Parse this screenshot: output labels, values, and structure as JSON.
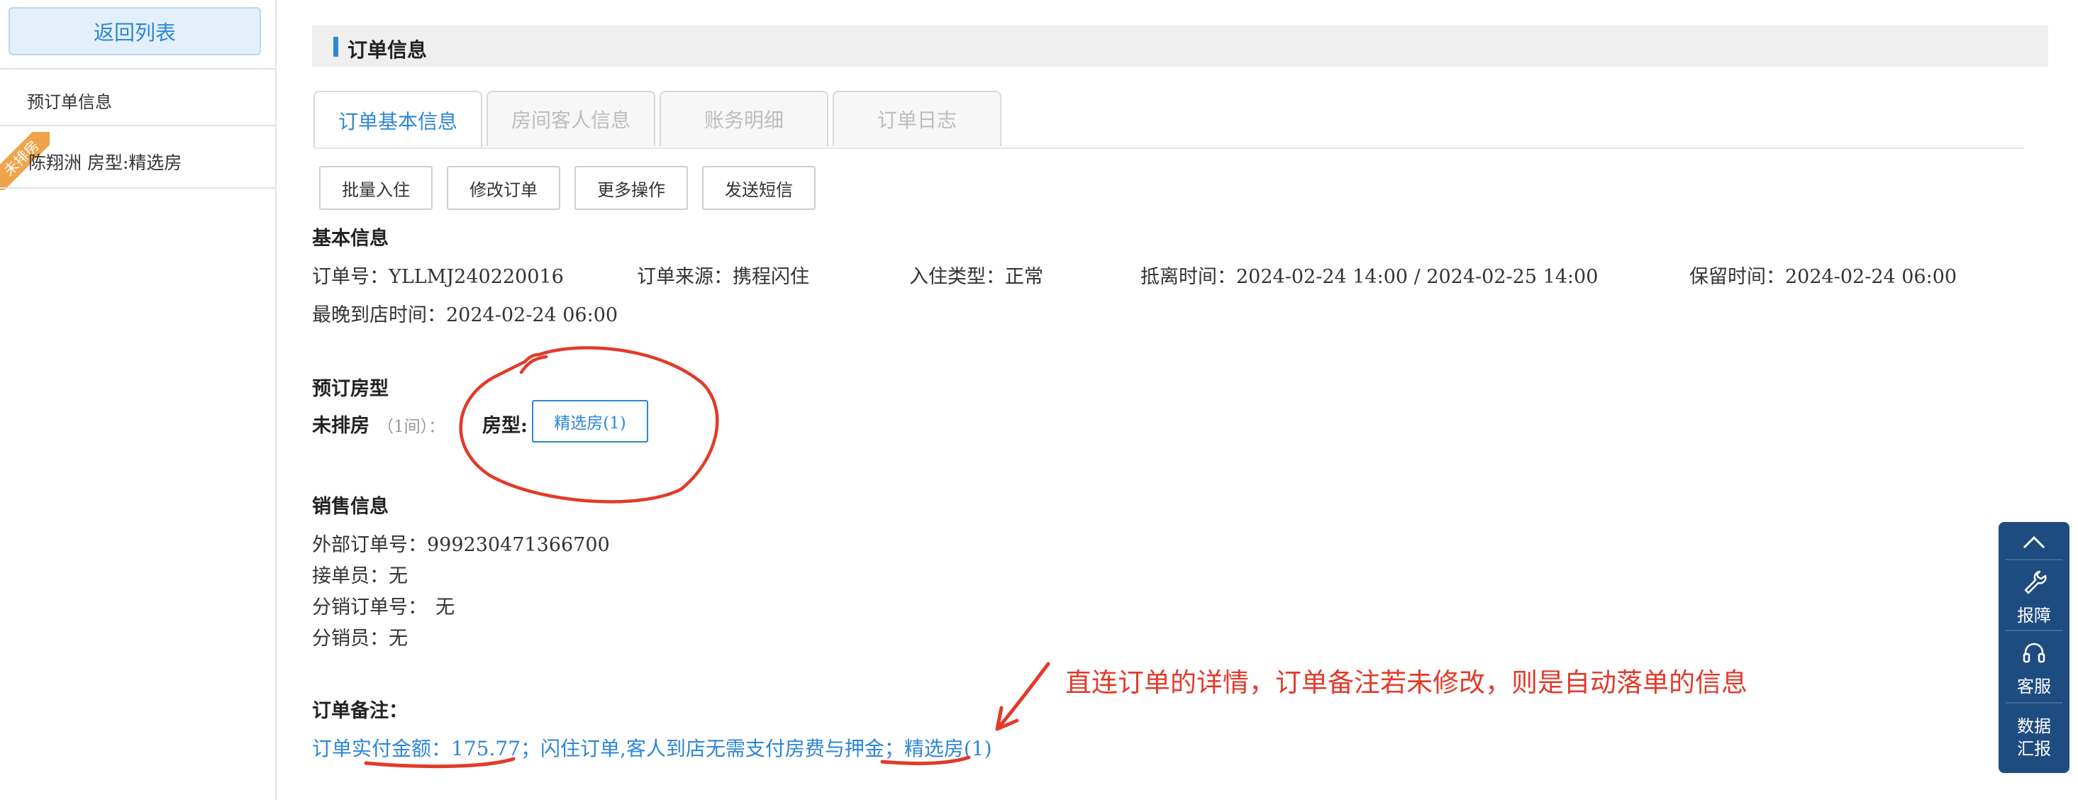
{
  "sidebar": {
    "back_label": "返回列表",
    "section_title": "预订单信息",
    "ribbon": "未排房",
    "order_item": "陈翔洲  房型:精选房"
  },
  "header": {
    "title": "订单信息"
  },
  "tabs": [
    {
      "label": "订单基本信息",
      "active": true
    },
    {
      "label": "房间客人信息",
      "active": false
    },
    {
      "label": "账务明细",
      "active": false
    },
    {
      "label": "订单日志",
      "active": false
    }
  ],
  "actions": [
    "批量入住",
    "修改订单",
    "更多操作",
    "发送短信"
  ],
  "basic": {
    "title": "基本信息",
    "order_no_k": "订单号：",
    "order_no_v": "YLLMJ240220016",
    "source_k": "订单来源：",
    "source_v": "携程闪住",
    "checkin_type_k": "入住类型：",
    "checkin_type_v": "正常",
    "period_k": "抵离时间：",
    "period_v": "2024-02-24 14:00 / 2024-02-25 14:00",
    "hold_k": "保留时间：",
    "hold_v": "2024-02-24 06:00",
    "latest_k": "最晚到店时间：",
    "latest_v": "2024-02-24 06:00"
  },
  "room": {
    "title": "预订房型",
    "unassigned": "未排房",
    "count": "（1间）：",
    "type_label": "房型:",
    "type_button": "精选房(1)"
  },
  "sales": {
    "title": "销售信息",
    "ext_no_k": "外部订单号：",
    "ext_no_v": "999230471366700",
    "receiver_k": "接单员：",
    "receiver_v": "无",
    "dist_no_k": "分销订单号：",
    "dist_no_v": "无",
    "dist_person_k": "分销员：",
    "dist_person_v": "无"
  },
  "remark": {
    "title": "订单备注：",
    "text": "订单实付金额：175.77；闪住订单,客人到店无需支付房费与押金；精选房(1)"
  },
  "annotation": "直连订单的详情，订单备注若未修改，则是自动落单的信息",
  "float_panel": {
    "report": "报障",
    "service": "客服",
    "data_line1": "数据",
    "data_line2": "汇报"
  },
  "colors": {
    "accent": "#2d86d8",
    "annotation_red": "#e23a2a",
    "panel_bg": "#1f4c80"
  }
}
